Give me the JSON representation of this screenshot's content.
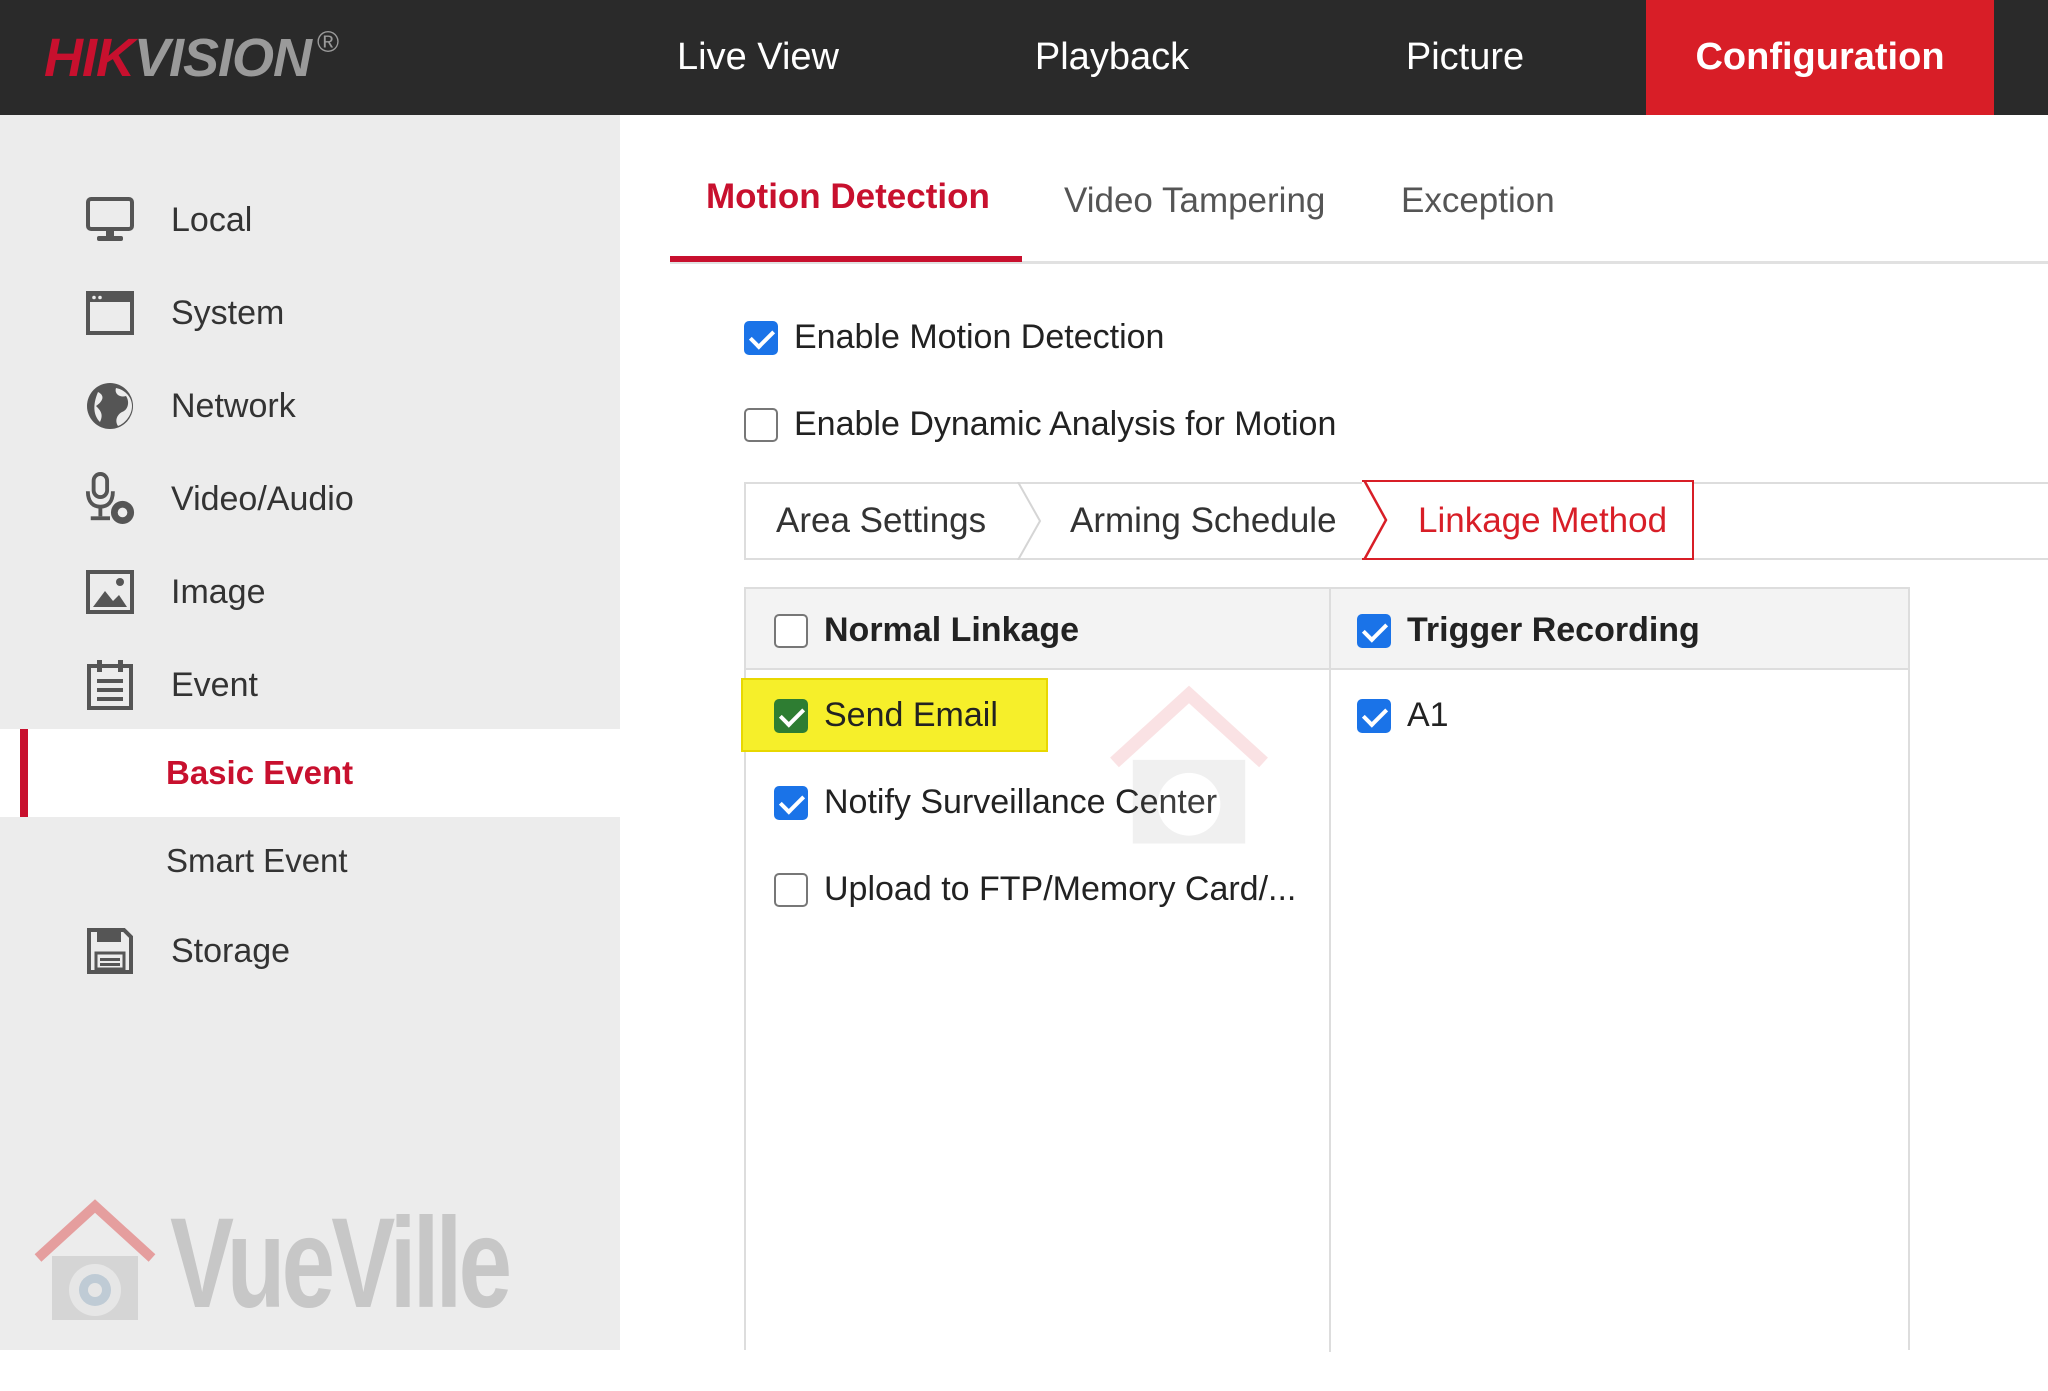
{
  "header": {
    "logo": {
      "brand_red": "HIK",
      "brand_grey": "VISION",
      "reg": "®"
    },
    "nav": [
      {
        "label": "Live View"
      },
      {
        "label": "Playback"
      },
      {
        "label": "Picture"
      },
      {
        "label": "Configuration",
        "active": true
      }
    ]
  },
  "sidebar": {
    "items": [
      {
        "label": "Local",
        "icon": "monitor-icon"
      },
      {
        "label": "System",
        "icon": "window-icon"
      },
      {
        "label": "Network",
        "icon": "globe-icon"
      },
      {
        "label": "Video/Audio",
        "icon": "microphone-camera-icon"
      },
      {
        "label": "Image",
        "icon": "image-icon"
      },
      {
        "label": "Event",
        "icon": "calendar-icon"
      },
      {
        "label": "Storage",
        "icon": "floppy-disk-icon"
      }
    ],
    "event_sub": [
      {
        "label": "Basic Event",
        "active": true
      },
      {
        "label": "Smart Event"
      }
    ]
  },
  "watermark": {
    "text": "VueVille"
  },
  "tabs": [
    {
      "label": "Motion Detection",
      "active": true
    },
    {
      "label": "Video Tampering"
    },
    {
      "label": "Exception"
    }
  ],
  "options": {
    "enable_motion": {
      "label": "Enable Motion Detection",
      "checked": true
    },
    "enable_dynamic": {
      "label": "Enable Dynamic Analysis for Motion",
      "checked": false
    }
  },
  "steps": [
    {
      "label": "Area Settings"
    },
    {
      "label": "Arming Schedule"
    },
    {
      "label": "Linkage Method",
      "active": true
    }
  ],
  "linkage": {
    "normal": {
      "header": "Normal Linkage",
      "checked": false,
      "items": [
        {
          "label": "Send Email",
          "checked": true,
          "highlighted": true
        },
        {
          "label": "Notify Surveillance Center",
          "checked": true
        },
        {
          "label": "Upload to FTP/Memory Card/...",
          "checked": false
        }
      ]
    },
    "trigger": {
      "header": "Trigger Recording",
      "checked": true,
      "items": [
        {
          "label": "A1",
          "checked": true
        }
      ]
    }
  },
  "colors": {
    "accent_red": "#d81e27",
    "checkbox_blue": "#1a73e8",
    "highlight_yellow": "#f6ef2a",
    "topbar": "#2a2a2a"
  }
}
